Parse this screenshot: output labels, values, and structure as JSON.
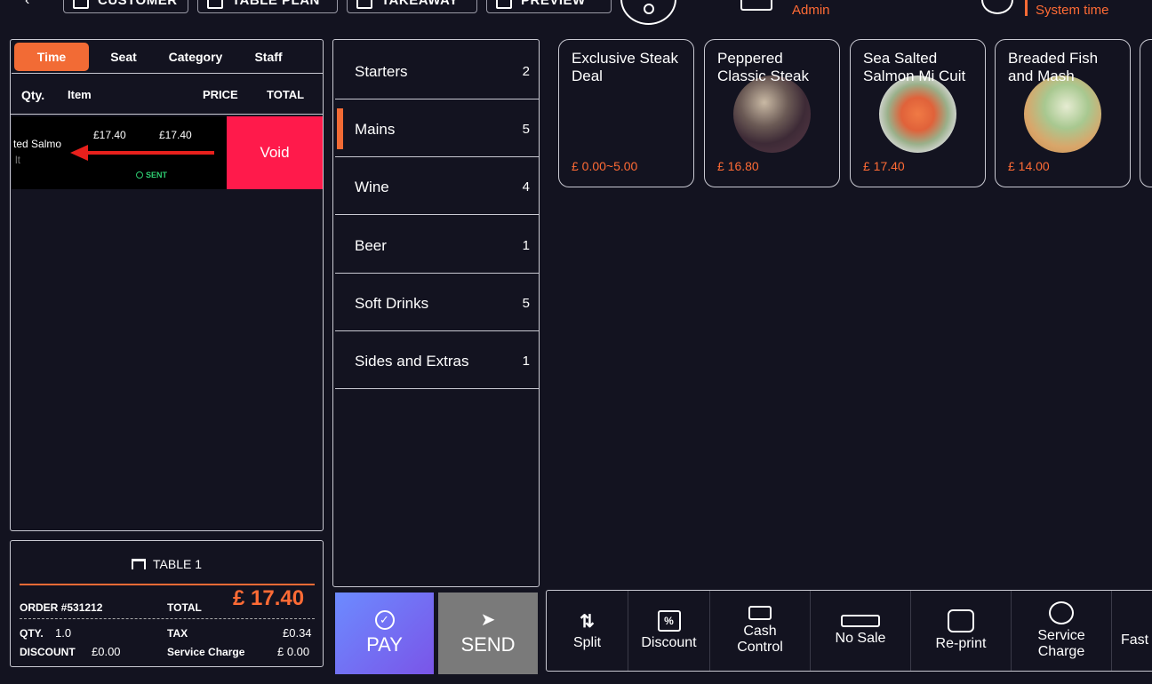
{
  "topbar": {
    "customer_label": "CUSTOMER",
    "table_plan_label": "TABLE PLAN",
    "takeaway_label": "TAKEAWAY",
    "preview_label": "PREVIEW",
    "user_name": "Admin",
    "system_time_label": "System time"
  },
  "sort_tabs": {
    "time": "Time",
    "seat": "Seat",
    "category": "Category",
    "staff": "Staff"
  },
  "order_header": {
    "qty": "Qty.",
    "item": "Item",
    "price": "PRICE",
    "total": "TOTAL"
  },
  "order_item": {
    "name": "ted Salmo",
    "sub": "lt",
    "price": "£17.40",
    "total": "£17.40",
    "status": "SENT",
    "void_label": "Void"
  },
  "totals": {
    "table_label": "TABLE 1",
    "order_number": "ORDER #531212",
    "total_label": "TOTAL",
    "total_value": "£ 17.40",
    "qty_label": "QTY.",
    "qty_value": "1.0",
    "tax_label": "TAX",
    "tax_value": "£0.34",
    "discount_label": "DISCOUNT",
    "discount_value": "£0.00",
    "service_label": "Service Charge",
    "service_value": "£ 0.00"
  },
  "categories": [
    {
      "name": "Starters",
      "count": "2"
    },
    {
      "name": "Mains",
      "count": "5"
    },
    {
      "name": "Wine",
      "count": "4"
    },
    {
      "name": "Beer",
      "count": "1"
    },
    {
      "name": "Soft Drinks",
      "count": "5"
    },
    {
      "name": "Sides and Extras",
      "count": "1"
    }
  ],
  "products": [
    {
      "name": "Exclusive Steak Deal",
      "price": "£ 0.00~5.00"
    },
    {
      "name": "Peppered Classic Steak",
      "price": "£ 16.80"
    },
    {
      "name": "Sea Salted Salmon Mi Cuit",
      "price": "£ 17.40"
    },
    {
      "name": "Breaded Fish and Mash",
      "price": "£ 14.00"
    }
  ],
  "actions": {
    "pay_label": "PAY",
    "send_label": "SEND"
  },
  "functions": {
    "split": "Split",
    "discount": "Discount",
    "cash_control_1": "Cash",
    "cash_control_2": "Control",
    "no_sale": "No Sale",
    "reprint": "Re-print",
    "service_charge_1": "Service",
    "service_charge_2": "Charge",
    "fast": "Fast"
  },
  "colors": {
    "accent": "#f26b35",
    "void": "#ff1a4b",
    "sent": "#2ecc71",
    "background": "#131320"
  }
}
